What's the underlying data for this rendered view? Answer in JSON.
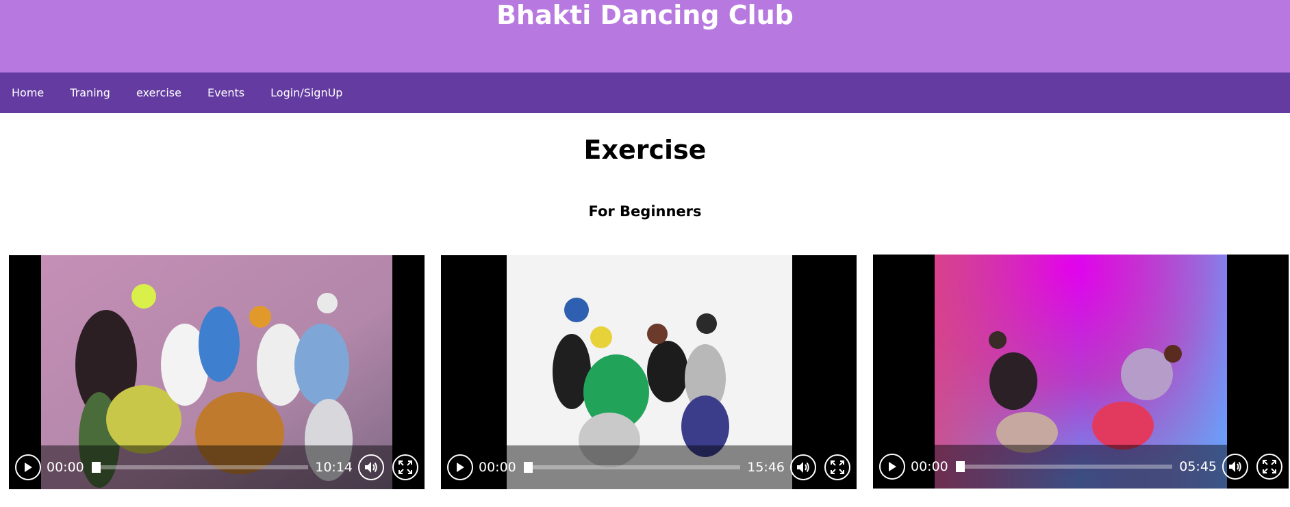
{
  "header": {
    "title": "Bhakti Dancing Club"
  },
  "nav": {
    "items": [
      {
        "label": "Home"
      },
      {
        "label": "Traning"
      },
      {
        "label": "exercise"
      },
      {
        "label": "Events"
      },
      {
        "label": "Login/SignUp"
      }
    ]
  },
  "main": {
    "title": "Exercise",
    "section": "For Beginners",
    "videos": [
      {
        "current_time": "00:00",
        "duration": "10:14",
        "progress": 0
      },
      {
        "current_time": "00:00",
        "duration": "15:46",
        "progress": 0
      },
      {
        "current_time": "00:00",
        "duration": "05:45",
        "progress": 0
      }
    ]
  },
  "colors": {
    "header": "#b779e0",
    "nav": "#633ba1"
  },
  "icons": [
    "play-icon",
    "volume-icon",
    "fullscreen-icon"
  ]
}
